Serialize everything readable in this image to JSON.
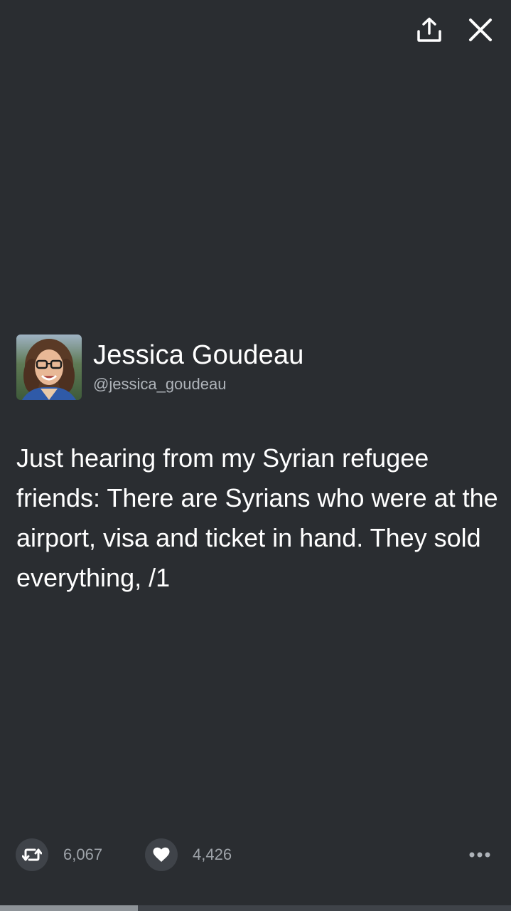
{
  "header": {
    "share_icon": "share-upload-icon",
    "close_icon": "close-icon"
  },
  "tweet": {
    "author_name": "Jessica Goudeau",
    "author_handle": "@jessica_goudeau",
    "text": "Just hearing from my Syrian refugee friends: There are Syrians who were at the airport, visa and ticket in hand. They sold everything, /1"
  },
  "actions": {
    "retweet_icon": "retweet-icon",
    "retweet_count": "6,067",
    "like_icon": "heart-icon",
    "like_count": "4,426",
    "more_icon": "more-dots-icon"
  },
  "progress": {
    "fraction": 0.27
  },
  "colors": {
    "background": "#2a2d31",
    "button_bg": "#3f4349",
    "secondary_text": "#aeb3b9"
  }
}
